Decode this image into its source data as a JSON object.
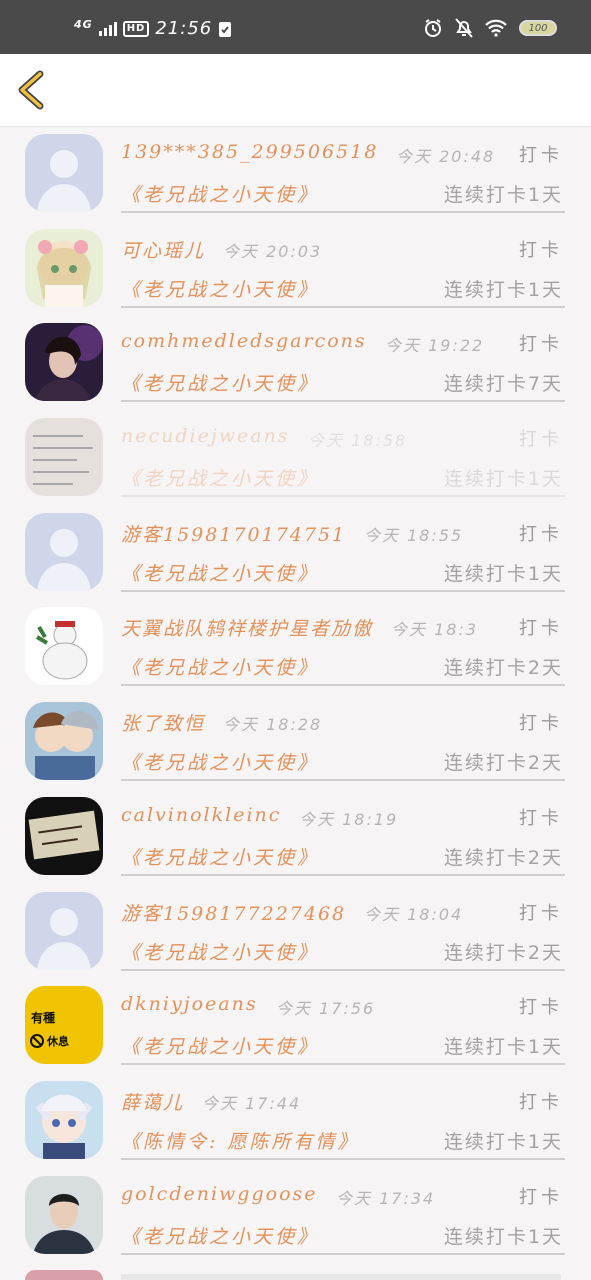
{
  "status_bar": {
    "network": "4G",
    "hd": "HD",
    "time": "21:56",
    "battery": "100"
  },
  "header": {
    "back_icon": "chevron-left-icon",
    "accent": "#f0c040"
  },
  "rows": [
    {
      "name": "139***385_299506518",
      "time": "今天 20:48",
      "action": "打卡",
      "book": "《老兄战之小天使》",
      "streak": "连续打卡1天",
      "avatar": "default"
    },
    {
      "name": "可心瑶儿",
      "time": "今天 20:03",
      "action": "打卡",
      "book": "《老兄战之小天使》",
      "streak": "连续打卡1天",
      "avatar": "anime-girl"
    },
    {
      "name": "comhmedledsgarcons",
      "time": "今天 19:22",
      "action": "打卡",
      "book": "《老兄战之小天使》",
      "streak": "连续打卡7天",
      "avatar": "portrait-dark"
    },
    {
      "name": "necudiejweans",
      "time": "今天 18:58",
      "action": "打卡",
      "book": "《老兄战之小天使》",
      "streak": "连续打卡1天",
      "avatar": "handwriting"
    },
    {
      "name": "游客15981701747​51",
      "time": "今天 18:55",
      "action": "打卡",
      "book": "《老兄战之小天使》",
      "streak": "连续打卡1天",
      "avatar": "default"
    },
    {
      "name": "天翼战队鸫祥楼护星者劢傲",
      "time": "今天 18:3",
      "action": "打卡",
      "book": "《老兄战之小天使》",
      "streak": "连续打卡2天",
      "avatar": "snowman"
    },
    {
      "name": "张了致恒",
      "time": "今天 18:28",
      "action": "打卡",
      "book": "《老兄战之小天使》",
      "streak": "连续打卡2天",
      "avatar": "anime-boys"
    },
    {
      "name": "calvinolkleinc",
      "time": "今天 18:19",
      "action": "打卡",
      "book": "《老兄战之小天使》",
      "streak": "连续打卡2天",
      "avatar": "note"
    },
    {
      "name": "游客15981772274​68",
      "time": "今天 18:04",
      "action": "打卡",
      "book": "《老兄战之小天使》",
      "streak": "连续打卡2天",
      "avatar": "default"
    },
    {
      "name": "dkniyjoeans",
      "time": "今天 17:56",
      "action": "打卡",
      "book": "《老兄战之小天使》",
      "streak": "连续打卡1天",
      "avatar": "yellow-sign"
    },
    {
      "name": "薛蔼儿",
      "time": "今天 17:44",
      "action": "打卡",
      "book": "《陈情令: 愿陈所有情》",
      "streak": "连续打卡1天",
      "avatar": "anime-cat"
    },
    {
      "name": "golcdeniwggoose",
      "time": "今天 17:34",
      "action": "打卡",
      "book": "《老兄战之小天使》",
      "streak": "连续打卡1天",
      "avatar": "photo-man"
    }
  ],
  "yellow_sign": {
    "line1": "有種",
    "line2": "休息"
  }
}
